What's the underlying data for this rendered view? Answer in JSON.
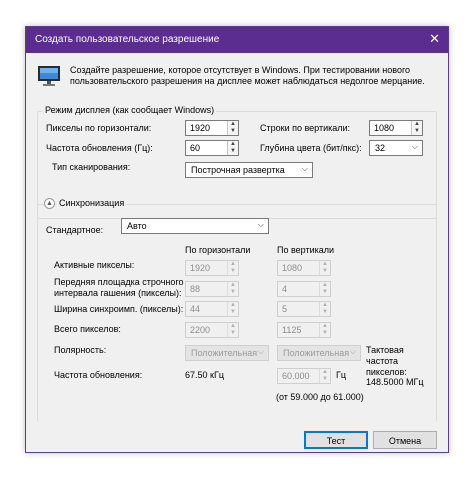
{
  "window": {
    "title": "Создать пользовательское разрешение",
    "close_glyph": "✕",
    "description": "Создайте разрешение, которое отсутствует в Windows. При тестировании нового пользовательского разрешения на дисплее может наблюдаться недолгое мерцание."
  },
  "display_mode": {
    "group_label": "Режим дисплея (как сообщает Windows)",
    "horizontal_pixels_label": "Пикселы по горизонтали:",
    "horizontal_pixels_value": "1920",
    "vertical_lines_label": "Строки по вертикали:",
    "vertical_lines_value": "1080",
    "refresh_rate_label": "Частота обновления (Гц):",
    "refresh_rate_value": "60",
    "color_depth_label": "Глубина цвета (бит/пкс):",
    "color_depth_value": "32",
    "scan_type_label": "Тип сканирования:",
    "scan_type_value": "Построчная развертка"
  },
  "sync": {
    "group_label": "Синхронизация",
    "standard_label": "Стандартное:",
    "standard_value": "Авто",
    "col_horizontal": "По горизонтали",
    "col_vertical": "По вертикали",
    "active_pixels_label": "Активные пикселы:",
    "active_h": "1920",
    "active_v": "1080",
    "front_porch_label": "Передняя площадка строчного интервала гашения (пикселы):",
    "front_porch_h": "88",
    "front_porch_v": "4",
    "sync_width_label": "Ширина синхроимп. (пикселы):",
    "sync_width_h": "44",
    "sync_width_v": "5",
    "total_pixels_label": "Всего пикселов:",
    "total_h": "2200",
    "total_v": "1125",
    "polarity_label": "Полярность:",
    "polarity_h": "Положительная",
    "polarity_v": "Положительная",
    "refresh_label": "Частота обновления:",
    "refresh_khz": "67.50 кГц",
    "refresh_hz_value": "60.000",
    "refresh_hz_unit": "Гц",
    "refresh_range": "(от 59.000 до 61.000)",
    "pixel_clock_label": "Тактовая частота пикселов:",
    "pixel_clock_value": "148.5000 МГц"
  },
  "buttons": {
    "test": "Тест",
    "cancel": "Отмена"
  },
  "glyphs": {
    "spin_up": "▲",
    "spin_down": "▼",
    "dropdown": "⌵",
    "collapse": "▲"
  },
  "colors": {
    "titlebar": "#5c2d91",
    "default_button_border": "#0078d7"
  }
}
